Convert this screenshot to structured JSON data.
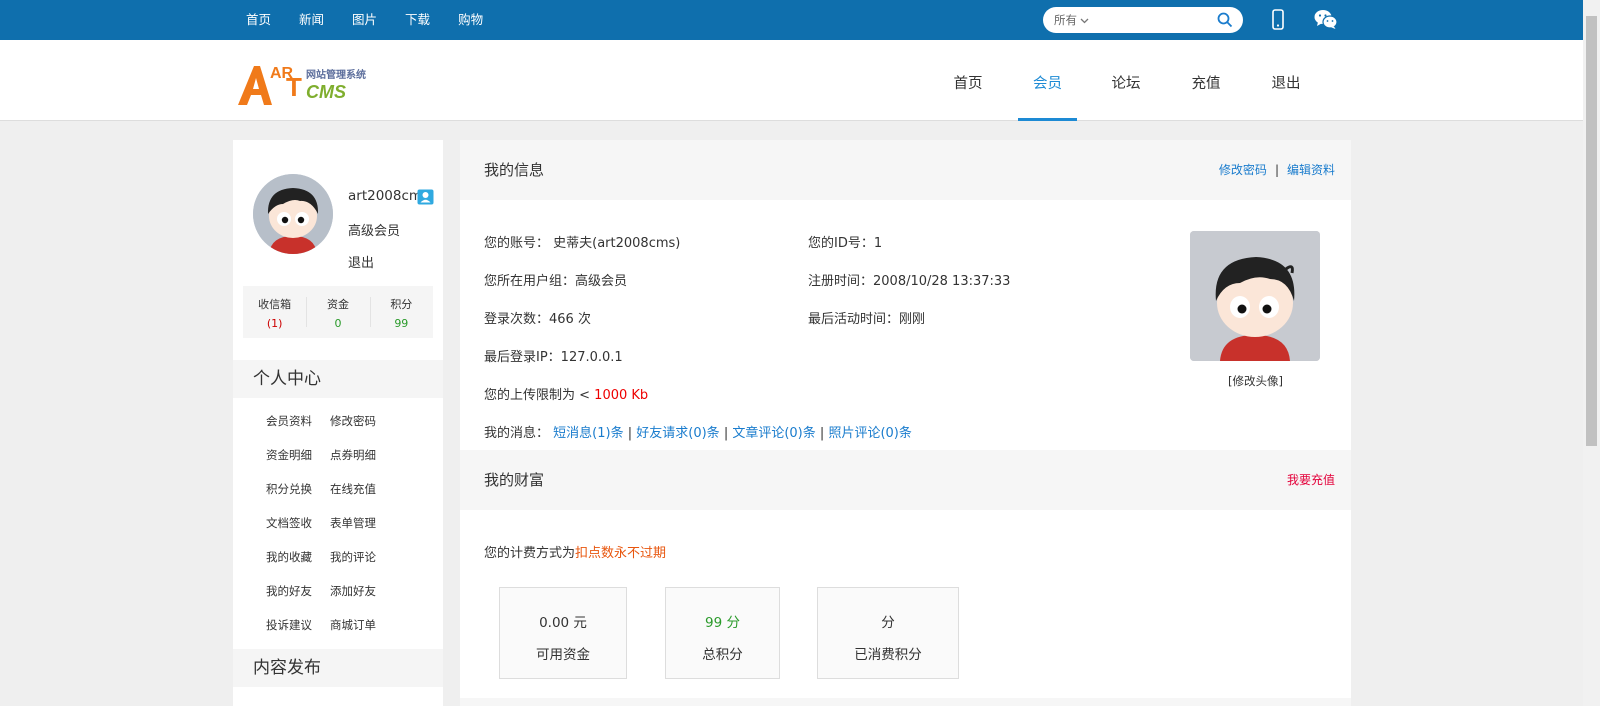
{
  "topnav": {
    "items": [
      "首页",
      "新闻",
      "图片",
      "下载",
      "购物"
    ]
  },
  "search": {
    "scope": "所有",
    "placeholder": ""
  },
  "logo": {
    "text_ar": "AR",
    "text_t": "T",
    "text_cms": "CMS",
    "slogan": "网站管理系统"
  },
  "mainnav": {
    "items": [
      "首页",
      "会员",
      "论坛",
      "充值",
      "退出"
    ],
    "active": "会员"
  },
  "user": {
    "name": "art2008cm",
    "group": "高级会员",
    "logout": "退出",
    "stats": [
      {
        "label": "收信箱",
        "value": "(1)",
        "color": "red"
      },
      {
        "label": "资金",
        "value": "0",
        "color": "green"
      },
      {
        "label": "积分",
        "value": "99",
        "color": "green"
      }
    ]
  },
  "sidebar": {
    "personal_title": "个人中心",
    "menu": [
      [
        "会员资料",
        "修改密码"
      ],
      [
        "资金明细",
        "点券明细"
      ],
      [
        "积分兑换",
        "在线充值"
      ],
      [
        "文档签收",
        "表单管理"
      ],
      [
        "我的收藏",
        "我的评论"
      ],
      [
        "我的好友",
        "添加好友"
      ],
      [
        "投诉建议",
        "商城订单"
      ]
    ],
    "publish_title": "内容发布"
  },
  "info": {
    "title": "我的信息",
    "link_password": "修改密码",
    "link_sep": "|",
    "link_profile": "编辑资料",
    "account": "您的账号： 史蒂夫(art2008cms)",
    "id": "您的ID号：1",
    "group": "您所在用户组：高级会员",
    "reg_time": "注册时间：2008/10/28 13:37:33",
    "login_count": "登录次数：466 次",
    "last_active": "最后活动时间：刚刚",
    "last_ip": "最后登录IP：127.0.0.1",
    "upload_prefix": "您的上传限制为 < ",
    "upload_value": "1000 Kb",
    "messages_prefix": "我的消息：",
    "msg_sms": "短消息(1)条",
    "msg_friend": "好友请求(0)条",
    "msg_article": "文章评论(0)条",
    "msg_photo": "照片评论(0)条",
    "pipe": "|",
    "edit_avatar": "[修改头像]"
  },
  "wealth": {
    "title": "我的财富",
    "recharge": "我要充值",
    "billing_prefix": "您的计费方式为",
    "billing_mode": "扣点数永不过期",
    "boxes": [
      {
        "value": "0.00 元",
        "label": "可用资金"
      },
      {
        "value": "99 分",
        "label": "总积分"
      },
      {
        "value": "分",
        "label": "已消费积分"
      }
    ]
  }
}
